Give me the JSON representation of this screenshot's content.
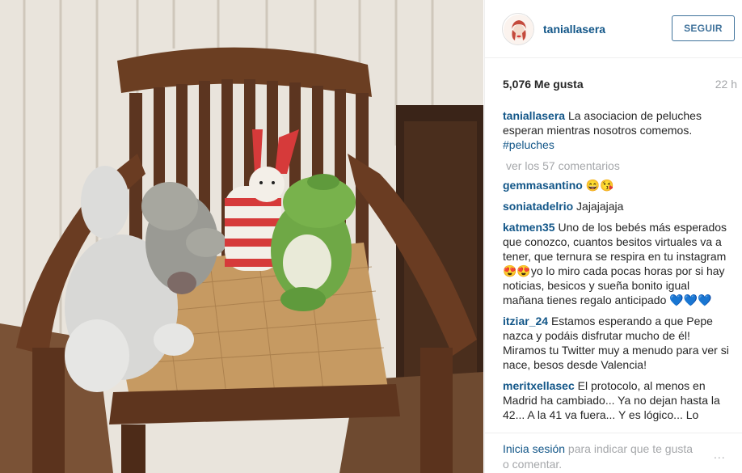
{
  "post": {
    "username": "taniallasera",
    "follow_label": "SEGUIR",
    "likes": "5,076 Me gusta",
    "time_ago": "22 h",
    "caption_user": "taniallasera",
    "caption_text": "La asociacion de peluches esperan mientras nosotros comemos.",
    "caption_tag": "#peluches",
    "view_all": "ver los 57 comentarios"
  },
  "comments": [
    {
      "user": "gemmasantino",
      "text": "😄😘"
    },
    {
      "user": "soniatadelrio",
      "text": "Jajajajaja"
    },
    {
      "user": "katmen35",
      "text": "Uno de los bebés más esperados que conozco, cuantos besitos virtuales va a tener, que ternura se respira en tu instagram 😍😍yo lo miro cada pocas horas por si hay noticias, besicos y sueña bonito igual mañana tienes regalo anticipado 💙💙💙"
    },
    {
      "user": "itziar_24",
      "text": "Estamos esperando a que Pepe nazca y podáis disfrutar mucho de él! Miramos tu Twitter muy a menudo para ver si nace, besos desde Valencia!"
    },
    {
      "user": "meritxellasec",
      "text": "El protocolo, al menos en Madrid ha cambiado... Ya no dejan hasta la 42... A la 41 va fuera... Y es lógico... Lo"
    }
  ],
  "footer": {
    "login_link": "Inicia sesión",
    "login_text": " para indicar que te gusta o comentar.",
    "more": "..."
  },
  "icons": {
    "avatar": "profile-avatar",
    "more": "more-options-icon"
  }
}
